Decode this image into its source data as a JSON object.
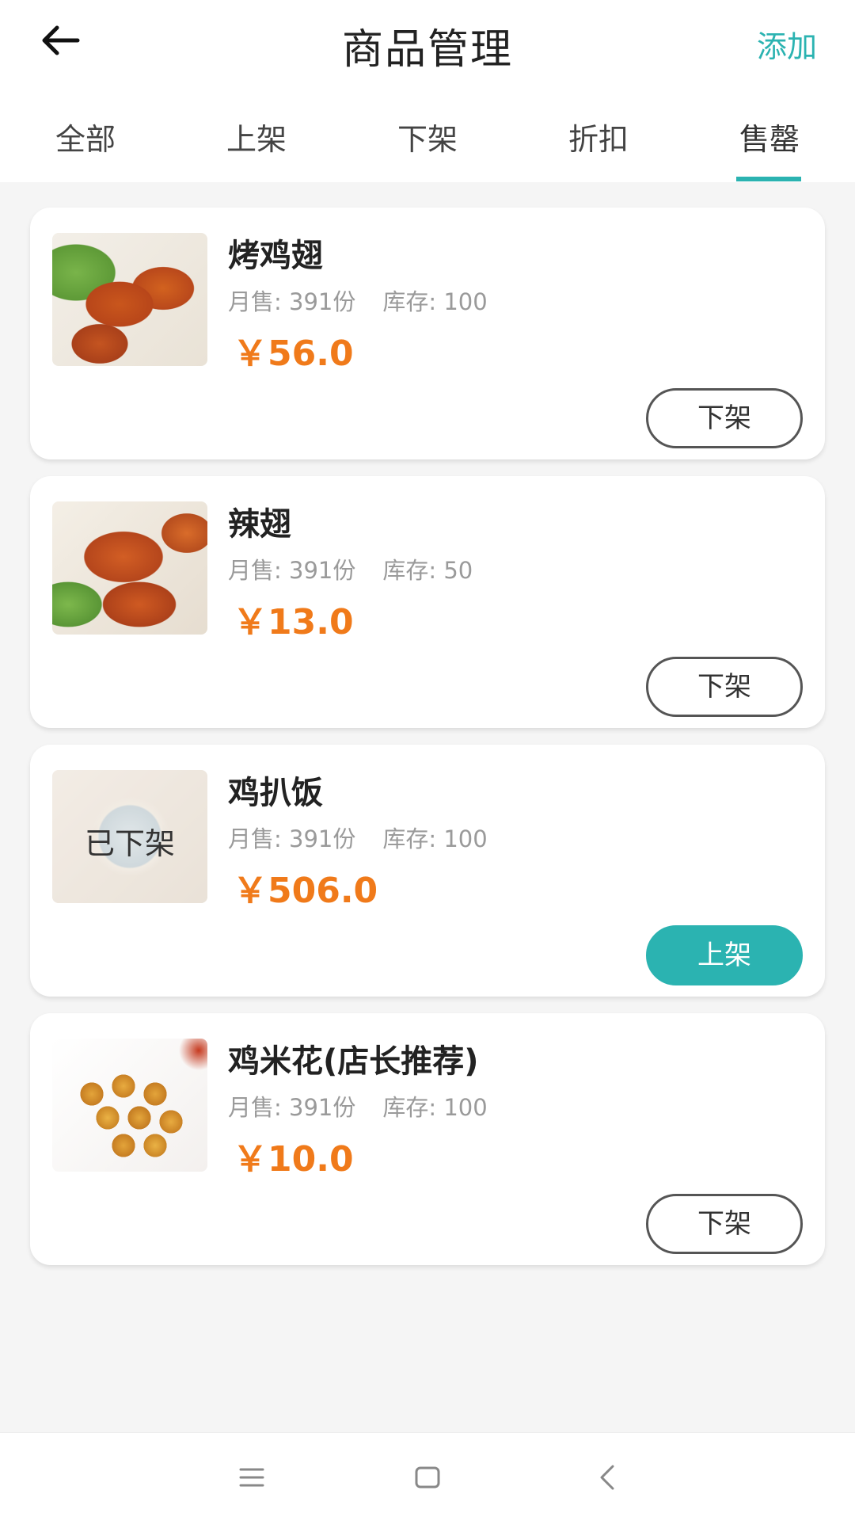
{
  "header": {
    "title": "商品管理",
    "add_label": "添加"
  },
  "tabs": [
    {
      "label": "全部"
    },
    {
      "label": "上架"
    },
    {
      "label": "下架"
    },
    {
      "label": "折扣"
    },
    {
      "label": "售罄"
    }
  ],
  "active_tab": "售罄",
  "products": [
    {
      "name": "烤鸡翅",
      "sales": "月售: 391份",
      "stock": "库存: 100",
      "price": "￥56.0",
      "action": "下架",
      "thumb_status": ""
    },
    {
      "name": "辣翅",
      "sales": "月售: 391份",
      "stock": "库存: 50",
      "price": "￥13.0",
      "action": "下架",
      "thumb_status": ""
    },
    {
      "name": "鸡扒饭",
      "sales": "月售: 391份",
      "stock": "库存: 100",
      "price": "￥506.0",
      "action": "上架",
      "thumb_status": "已下架"
    },
    {
      "name": "鸡米花(店长推荐)",
      "sales": "月售: 391份",
      "stock": "库存: 100",
      "price": "￥10.0",
      "action": "下架",
      "thumb_status": ""
    }
  ],
  "colors": {
    "accent": "#2bb3b1",
    "price": "#f07a1a",
    "background": "#f5f5f5"
  },
  "icons": {
    "back": "arrow-left-icon",
    "nav_menu": "menu-icon",
    "nav_home": "home-square-icon",
    "nav_back": "chevron-left-icon"
  }
}
